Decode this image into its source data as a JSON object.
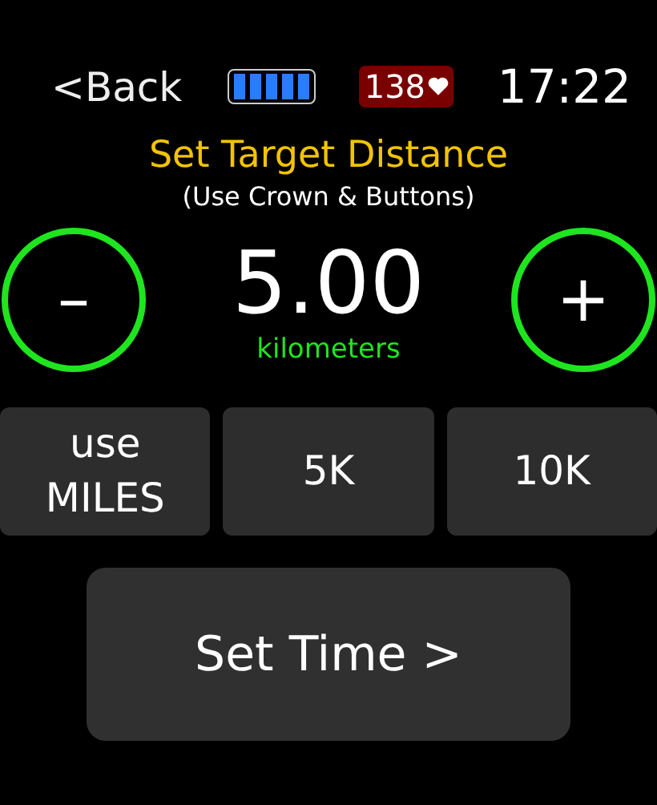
{
  "status_bar": {
    "back": "<Back",
    "battery": {
      "level": 1
    },
    "heart_rate": "138",
    "time": "17:22"
  },
  "title": "Set Target Distance",
  "subtitle": "(Use Crown & Buttons)",
  "stepper": {
    "decrement": "–",
    "value": "5.00",
    "unit": "kilometers",
    "increment": "+"
  },
  "presets": [
    {
      "label": "use\nMILES"
    },
    {
      "label": "5K"
    },
    {
      "label": "10K"
    }
  ],
  "action_button": "Set Time >"
}
